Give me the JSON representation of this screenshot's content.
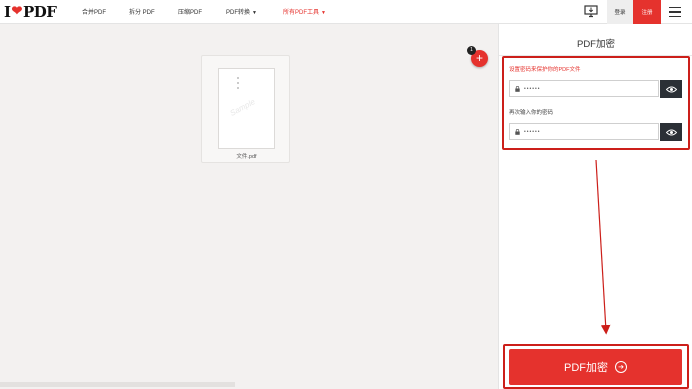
{
  "header": {
    "logo_prefix": "I",
    "logo_suffix": "PDF",
    "nav": [
      {
        "label": "合并PDF",
        "caret": false,
        "active": false
      },
      {
        "label": "拆分 PDF",
        "caret": false,
        "active": false
      },
      {
        "label": "压缩PDF",
        "caret": false,
        "active": false
      },
      {
        "label": "PDF转换",
        "caret": true,
        "active": false
      },
      {
        "label": "所有PDF工具",
        "caret": true,
        "active": true
      }
    ],
    "login_label": "登录",
    "signup_label": "注册"
  },
  "workspace": {
    "file_name": "文件.pdf",
    "thumb_watermark": "Sample",
    "add_badge_count": "1"
  },
  "sidebar": {
    "title": "PDF加密",
    "password_label": "设置密码来保护你的PDF文件",
    "password_value": "••••••",
    "confirm_label": "再次输入你的密码",
    "confirm_value": "••••••",
    "submit_label": "PDF加密"
  },
  "colors": {
    "brand_red": "#e5322d",
    "annotation_red": "#cc1f1a",
    "eye_button": "#2b3036"
  }
}
